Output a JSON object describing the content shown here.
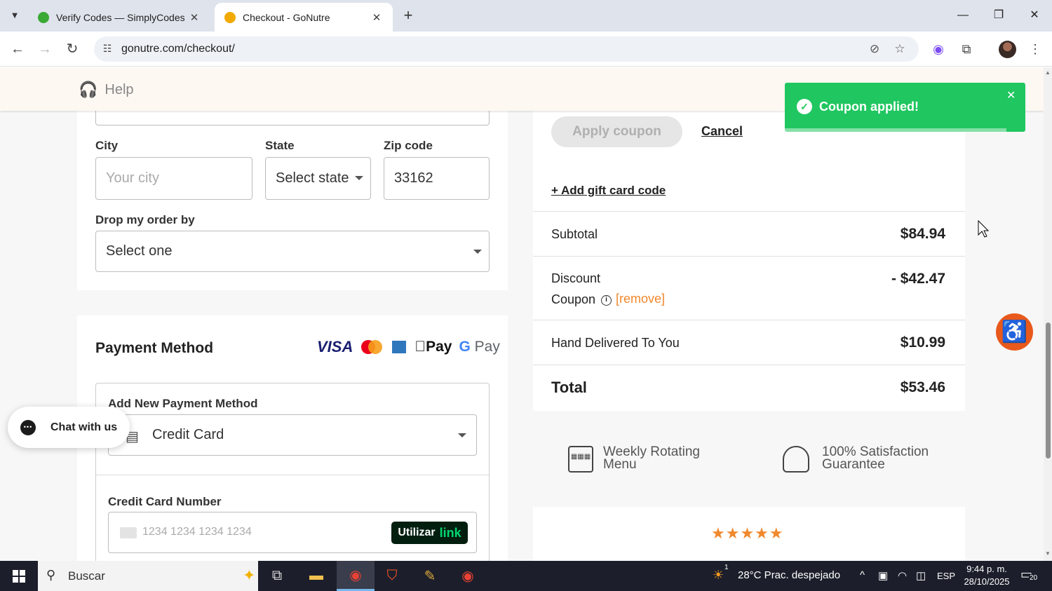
{
  "browser": {
    "tabs": [
      {
        "title": "Verify Codes — SimplyCodes",
        "active": false,
        "favicon_color": "#3aa935"
      },
      {
        "title": "Checkout - GoNutre",
        "active": true,
        "favicon_color": "#f2a900"
      }
    ],
    "url": "gonutre.com/checkout/"
  },
  "header": {
    "help_label": "Help"
  },
  "address_form": {
    "city_label": "City",
    "city_placeholder": "Your city",
    "state_label": "State",
    "state_value": "Select state",
    "zip_label": "Zip code",
    "zip_value": "33162",
    "drop_label": "Drop my order by",
    "drop_value": "Select one"
  },
  "payment": {
    "title": "Payment Method",
    "brands": [
      "VISA",
      "Mastercard",
      "Amex",
      "Apple Pay",
      "G Pay"
    ],
    "apple_pay_label": "Pay",
    "google_pay_label": "Pay",
    "add_new_label": "Add New Payment Method",
    "method_value": "Credit Card",
    "cc_number_label": "Credit Card Number",
    "cc_number_placeholder": "1234 1234 1234 1234",
    "link_button": {
      "prefix": "Utilizar",
      "brand": "link"
    }
  },
  "chat": {
    "label": "Chat with us"
  },
  "summary": {
    "apply_coupon_label": "Apply coupon",
    "cancel_label": "Cancel",
    "add_gift_label": "+ Add gift card code",
    "subtotal_label": "Subtotal",
    "subtotal_value": "$84.94",
    "discount_label": "Discount",
    "discount_value": "- $42.47",
    "coupon_label": "Coupon",
    "remove_label": "[remove]",
    "delivery_label": "Hand Delivered To You",
    "delivery_value": "$10.99",
    "total_label": "Total",
    "total_value": "$53.46",
    "accent_color": "#f0882d"
  },
  "features": [
    {
      "line1": "Weekly Rotating",
      "line2": "Menu",
      "icon": "calendar-icon"
    },
    {
      "line1": "100% Satisfaction",
      "line2": "Guarantee",
      "icon": "chef-hat-icon"
    }
  ],
  "reviews": {
    "stars": "★★★★★",
    "rating": 5
  },
  "toast": {
    "message": "Coupon applied!",
    "color": "#20c660"
  },
  "taskbar": {
    "search_placeholder": "Buscar",
    "weather": "28°C  Prac. despejado",
    "weather_badge": "1",
    "language": "ESP",
    "time": "9:44 p. m.",
    "date": "28/10/2025",
    "notifications": "20"
  }
}
